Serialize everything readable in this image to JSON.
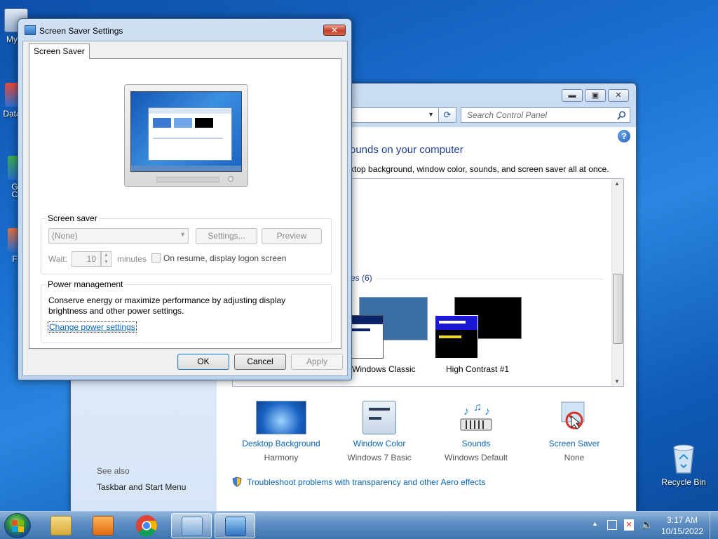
{
  "desktop": {
    "icons": [
      {
        "label": "My C",
        "name": "desktop-icon-my-computer"
      },
      {
        "label": "Data",
        "name": "desktop-icon-data"
      },
      {
        "label": "G",
        "name": "desktop-icon-g"
      },
      {
        "label": "C",
        "name": "desktop-icon-c"
      },
      {
        "label": "F",
        "name": "desktop-icon-f"
      }
    ],
    "recycle_bin": "Recycle Bin"
  },
  "control_panel": {
    "search_placeholder": "Search Control Panel",
    "help_glyph": "?",
    "heading": "ounds on your computer",
    "subheading": "ktop background, window color, sounds, and screen saver all at once.",
    "themes_group_label": "es (6)",
    "themes": [
      {
        "label": "Windows Classic"
      },
      {
        "label": "High Contrast #1"
      }
    ],
    "see_also_label": "See also",
    "see_also_links": [
      "Taskbar and Start Menu"
    ],
    "bottom_items": [
      {
        "label": "Desktop Background",
        "sub": "Harmony"
      },
      {
        "label": "Window Color",
        "sub": "Windows 7 Basic"
      },
      {
        "label": "Sounds",
        "sub": "Windows Default"
      },
      {
        "label": "Screen Saver",
        "sub": "None"
      }
    ],
    "troubleshoot_link": "Troubleshoot problems with transparency and other Aero effects"
  },
  "dialog": {
    "title": "Screen Saver Settings",
    "close_glyph": "✕",
    "tab_label": "Screen Saver",
    "screen_saver_group": "Screen saver",
    "screen_saver_value": "(None)",
    "settings_button": "Settings...",
    "preview_button": "Preview",
    "wait_label": "Wait:",
    "wait_value": "10",
    "minutes_label": "minutes",
    "resume_label": "On resume, display logon screen",
    "power_group": "Power management",
    "power_text_1": "Conserve energy or maximize performance by adjusting display",
    "power_text_2": "brightness and other power settings.",
    "power_link": "Change power settings",
    "ok_button": "OK",
    "cancel_button": "Cancel",
    "apply_button": "Apply"
  },
  "taskbar": {
    "time": "3:17 AM",
    "date": "10/15/2022",
    "up_arrow": "▲"
  }
}
